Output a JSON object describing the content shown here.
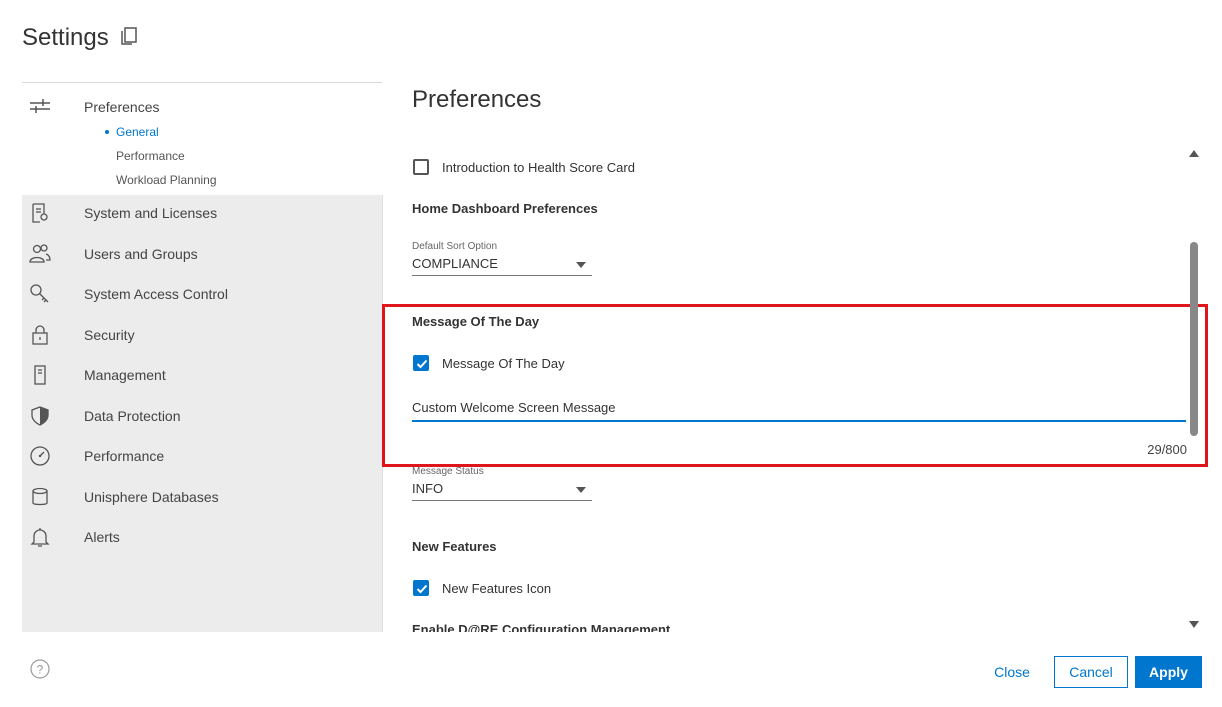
{
  "header": {
    "title": "Settings",
    "copy_icon": "copy-icon"
  },
  "sidebar": {
    "preferences": {
      "label": "Preferences",
      "icon": "sliders-icon",
      "subitems": [
        {
          "label": "General",
          "active": true
        },
        {
          "label": "Performance",
          "active": false
        },
        {
          "label": "Workload Planning",
          "active": false
        }
      ]
    },
    "items": [
      {
        "label": "System and Licenses",
        "icon": "license-icon"
      },
      {
        "label": "Users and Groups",
        "icon": "users-icon"
      },
      {
        "label": "System Access Control",
        "icon": "key-icon"
      },
      {
        "label": "Security",
        "icon": "lock-icon"
      },
      {
        "label": "Management",
        "icon": "server-icon"
      },
      {
        "label": "Data Protection",
        "icon": "shield-icon"
      },
      {
        "label": "Performance",
        "icon": "gauge-icon"
      },
      {
        "label": "Unisphere Databases",
        "icon": "database-icon"
      },
      {
        "label": "Alerts",
        "icon": "bell-icon"
      }
    ]
  },
  "main": {
    "title": "Preferences",
    "intro_checkbox": {
      "label": "Introduction to Health Score Card",
      "checked": false
    },
    "home_dashboard": {
      "heading": "Home Dashboard Preferences",
      "sort_label": "Default Sort Option",
      "sort_value": "COMPLIANCE"
    },
    "motd": {
      "heading": "Message Of The Day",
      "checkbox_label": "Message Of The Day",
      "checked": true,
      "message_value": "Custom Welcome Screen Message",
      "counter": "29/800",
      "status_label": "Message Status",
      "status_value": "INFO"
    },
    "new_features": {
      "heading": "New Features",
      "checkbox_label": "New Features Icon",
      "checked": true
    },
    "dare_heading": "Enable D@RE Configuration Management"
  },
  "footer": {
    "close_label": "Close",
    "cancel_label": "Cancel",
    "apply_label": "Apply"
  },
  "colors": {
    "accent": "#0076ce",
    "highlight": "#e0151b",
    "sidebar_bg": "#ececec"
  }
}
